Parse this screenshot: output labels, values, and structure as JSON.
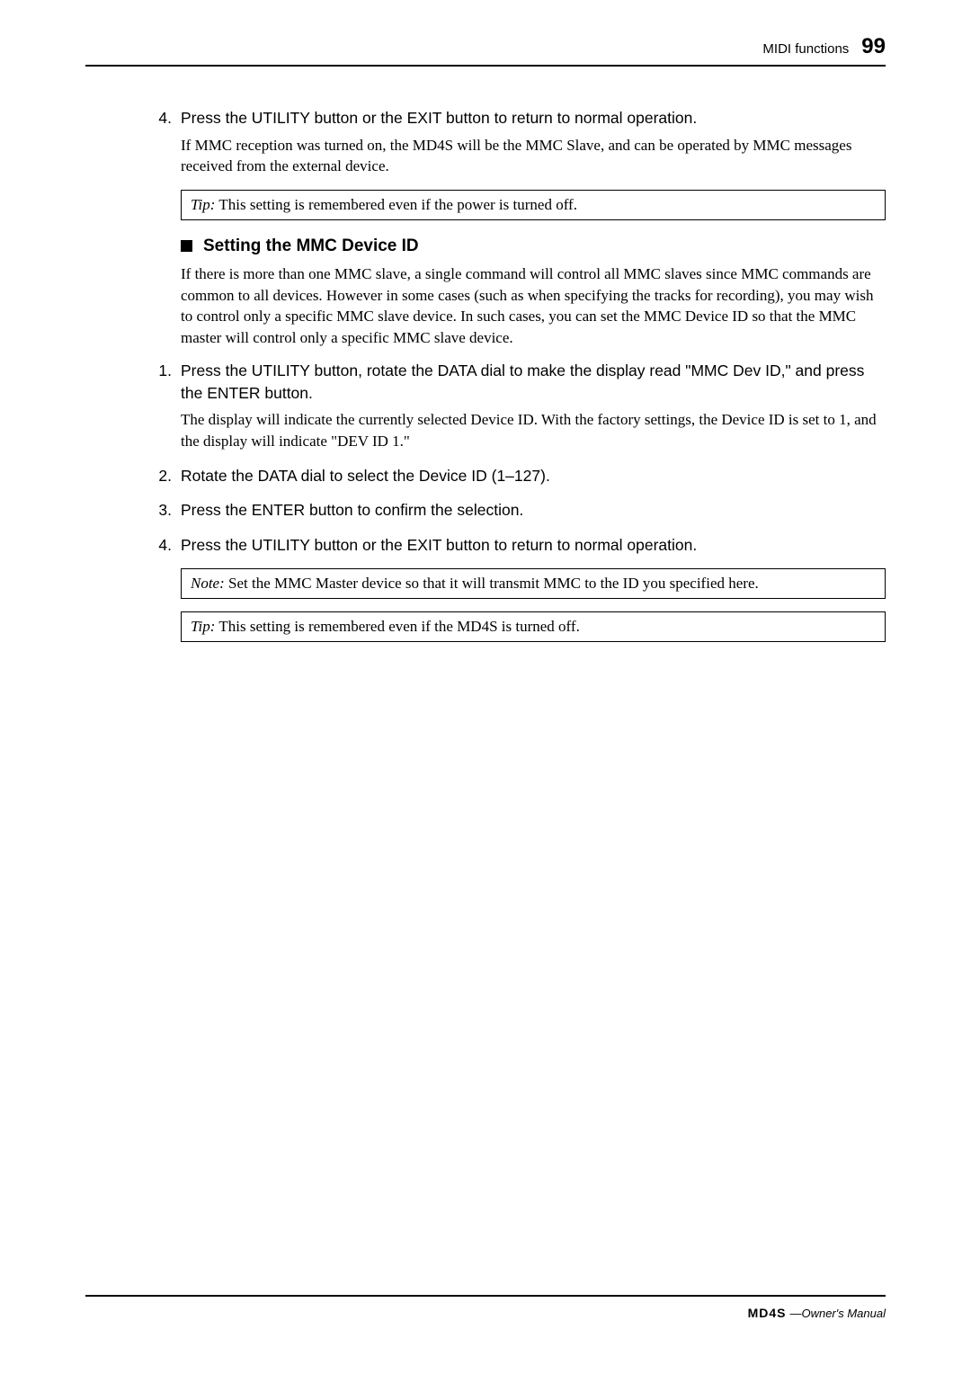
{
  "header": {
    "section_label": "MIDI functions",
    "page_number": "99"
  },
  "content": {
    "step4_top": {
      "num": "4.",
      "text": "Press the UTILITY button or the EXIT button to return to normal operation.",
      "body": "If MMC reception was turned on, the MD4S will be the MMC Slave, and can be operated by MMC messages received from the external device."
    },
    "tip1": {
      "label": "Tip:",
      "text": "This setting is remembered even if the power is turned off."
    },
    "section_heading": "Setting the MMC Device ID",
    "section_body": "If there is more than one MMC slave, a single command will control all MMC slaves since MMC commands are common to all devices. However in some cases (such as when specifying the tracks for recording), you may wish to control only a specific MMC slave device. In such cases, you can set the MMC Device ID so that the MMC master will control only a specific MMC slave device.",
    "step1": {
      "num": "1.",
      "text": "Press the UTILITY button, rotate the DATA dial to make the display read \"MMC Dev ID,\" and press the ENTER button.",
      "body": "The display will indicate the currently selected Device ID. With the factory settings, the Device ID is set to 1, and the display will indicate \"DEV ID 1.\""
    },
    "step2": {
      "num": "2.",
      "text": "Rotate the DATA dial to select the Device ID (1–127)."
    },
    "step3": {
      "num": "3.",
      "text": "Press the ENTER button to confirm the selection."
    },
    "step4": {
      "num": "4.",
      "text": "Press the UTILITY button or the EXIT button to return to normal operation."
    },
    "note": {
      "label": "Note:",
      "text": "Set the MMC Master device so that it will transmit MMC to the ID you specified here."
    },
    "tip2": {
      "label": "Tip:",
      "text": "This setting is remembered even if the MD4S is turned off."
    }
  },
  "footer": {
    "logo": "MD4S",
    "text": "—Owner's Manual"
  }
}
